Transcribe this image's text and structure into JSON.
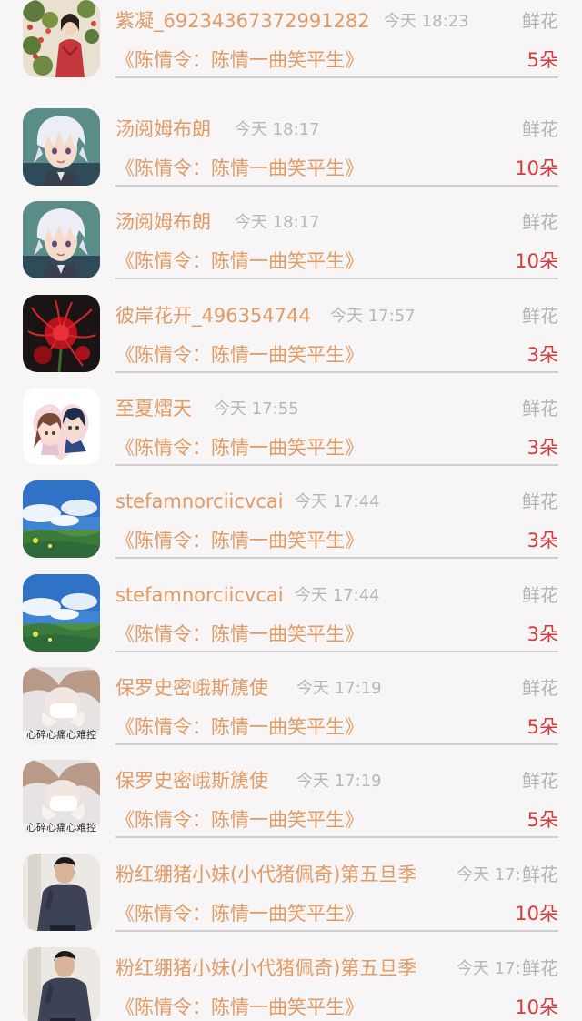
{
  "gifts": [
    {
      "name": "紫凝_69234367372991282",
      "time": "今天 18:23",
      "gift_type": "鲜花",
      "book": "《陈情令：陈情一曲笑平生》",
      "count": "5朵",
      "avatar": "woman-red-dress-flowers"
    },
    {
      "name": "汤阅姆布朗",
      "time": "今天 18:17",
      "gift_type": "鲜花",
      "book": "《陈情令：陈情一曲笑平生》",
      "count": "10朵",
      "avatar": "anime-white-hair-boy"
    },
    {
      "name": "汤阅姆布朗",
      "time": "今天 18:17",
      "gift_type": "鲜花",
      "book": "《陈情令：陈情一曲笑平生》",
      "count": "10朵",
      "avatar": "anime-white-hair-boy"
    },
    {
      "name": "彼岸花开_496354744",
      "time": "今天 17:57",
      "gift_type": "鲜花",
      "book": "《陈情令：陈情一曲笑平生》",
      "count": "3朵",
      "avatar": "red-spider-lily"
    },
    {
      "name": "至夏熠天",
      "time": "今天 17:55",
      "gift_type": "鲜花",
      "book": "《陈情令：陈情一曲笑平生》",
      "count": "3朵",
      "avatar": "anime-couple-heart"
    },
    {
      "name": "stefamnorciicvcai",
      "time": "今天 17:44",
      "gift_type": "鲜花",
      "book": "《陈情令：陈情一曲笑平生》",
      "count": "3朵",
      "avatar": "anime-sky-landscape"
    },
    {
      "name": "stefamnorciicvcai",
      "time": "今天 17:44",
      "gift_type": "鲜花",
      "book": "《陈情令：陈情一曲笑平生》",
      "count": "3朵",
      "avatar": "anime-sky-landscape"
    },
    {
      "name": "保罗史密峨斯篪使",
      "time": "今天 17:19",
      "gift_type": "鲜花",
      "book": "《陈情令：陈情一曲笑平生》",
      "count": "5朵",
      "avatar": "girl-mask-text",
      "avatar_text": "心碎心痛心难控"
    },
    {
      "name": "保罗史密峨斯篪使",
      "time": "今天 17:19",
      "gift_type": "鲜花",
      "book": "《陈情令：陈情一曲笑平生》",
      "count": "5朵",
      "avatar": "girl-mask-text",
      "avatar_text": "心碎心痛心难控"
    },
    {
      "name": "粉红绷猪小妹(小代猪佩奇)第五旦季",
      "time": "今天 17:",
      "gift_type": "鲜花",
      "book": "《陈情令：陈情一曲笑平生》",
      "count": "10朵",
      "avatar": "man-navy-sweater"
    },
    {
      "name": "粉红绷猪小妹(小代猪佩奇)第五旦季",
      "time": "今天 17:",
      "gift_type": "鲜花",
      "book": "《陈情令：陈情一曲笑平生》",
      "count": "10朵",
      "avatar": "man-navy-sweater"
    }
  ],
  "colors": {
    "name": "#e29a63",
    "time": "#b7b7b7",
    "gift_type": "#b3b3b3",
    "count": "#d53b3b",
    "background": "#f7f5f6",
    "divider": "#cfcfcf"
  }
}
